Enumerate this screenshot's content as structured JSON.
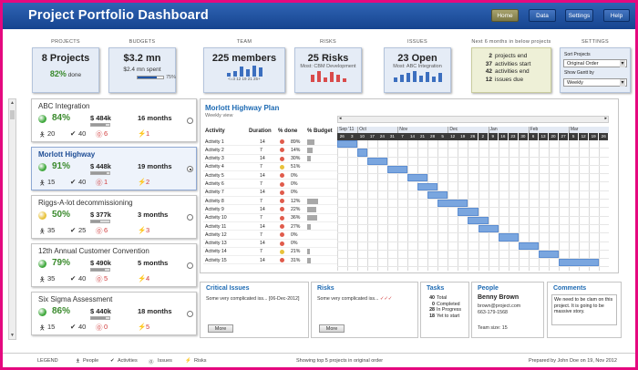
{
  "header": {
    "title": "Project Portfolio Dashboard",
    "buttons": [
      {
        "label": "Home"
      },
      {
        "label": "Data"
      },
      {
        "label": "Settings"
      },
      {
        "label": "Help"
      }
    ]
  },
  "kpis": {
    "projects": {
      "label": "PROJECTS",
      "value": "8 Projects",
      "pct": "82%",
      "pct_suffix": "done"
    },
    "budgets": {
      "label": "BUDGETS",
      "value": "$3.2 mn",
      "sub": "$2.4 mn spent",
      "bar_pct": "75%",
      "bar_fraction": 0.75
    },
    "team": {
      "label": "TEAM",
      "value": "225 members",
      "bars": [
        3,
        5,
        9,
        7,
        10,
        8
      ],
      "ticks": "<=3 12 19 21 25+"
    },
    "risks": {
      "label": "RISKS",
      "value": "25 Risks",
      "sub": "Most: CBM Development",
      "bars": [
        6,
        9,
        4,
        8,
        6,
        3
      ]
    },
    "issues": {
      "label": "ISSUES",
      "value": "23 Open",
      "sub": "Most: ABC Integration",
      "bars": [
        4,
        7,
        8,
        10,
        6,
        9,
        5,
        8
      ]
    },
    "next": {
      "label": "Next 6 months in below projects",
      "lines": [
        {
          "n": "2",
          "t": "projects end"
        },
        {
          "n": "37",
          "t": "activities start"
        },
        {
          "n": "42",
          "t": "activities end"
        },
        {
          "n": "12",
          "t": "issues due"
        }
      ]
    },
    "settings": {
      "label": "SETTINGS",
      "sort_label": "Sort Projects",
      "sort_value": "Original Order",
      "gantt_label": "Show Gantt by",
      "gantt_value": "Weekly"
    }
  },
  "projects": [
    {
      "name": "ABC Integration",
      "pct": "84%",
      "status_color": "#3fa83c",
      "budget": "$ 484k",
      "budget_fill": 0.8,
      "duration": "16 months",
      "people": "20",
      "activities": "40",
      "issues": "6",
      "risks": "1"
    },
    {
      "name": "Morlott Highway",
      "pct": "91%",
      "status_color": "#3fa83c",
      "budget": "$ 448k",
      "budget_fill": 0.85,
      "duration": "19 months",
      "people": "15",
      "activities": "40",
      "issues": "1",
      "risks": "2"
    },
    {
      "name": "Riggs-A-lot decommissioning",
      "pct": "50%",
      "status_color": "#e8c23a",
      "budget": "$ 377k",
      "budget_fill": 0.5,
      "duration": "3 months",
      "people": "35",
      "activities": "25",
      "issues": "6",
      "risks": "3"
    },
    {
      "name": "12th Annual Customer Convention",
      "pct": "79%",
      "status_color": "#3fa83c",
      "budget": "$ 490k",
      "budget_fill": 0.75,
      "duration": "5 months",
      "people": "35",
      "activities": "40",
      "issues": "5",
      "risks": "4"
    },
    {
      "name": "Six Sigma Assessment",
      "pct": "86%",
      "status_color": "#3fa83c",
      "budget": "$ 440k",
      "budget_fill": 0.8,
      "duration": "18 months",
      "people": "15",
      "activities": "40",
      "issues": "0",
      "risks": "5"
    }
  ],
  "detail": {
    "title": "Morlott Highway Plan",
    "subtitle": "Weekly view",
    "columns": {
      "activity": "Activity",
      "duration": "Duration",
      "pct": "% done",
      "budget": "% Budget"
    },
    "activities": [
      {
        "name": "Activity 1",
        "dur": "14",
        "color": "#e05b4b",
        "pct": "89%",
        "budget": 0.25
      },
      {
        "name": "Activity 2",
        "dur": "7",
        "color": "#e05b4b",
        "pct": "14%",
        "budget": 0.18
      },
      {
        "name": "Activity 3",
        "dur": "14",
        "color": "#e05b4b",
        "pct": "30%",
        "budget": 0.12
      },
      {
        "name": "Activity 4",
        "dur": "7",
        "color": "#e8c23a",
        "pct": "51%",
        "budget": 0
      },
      {
        "name": "Activity 5",
        "dur": "14",
        "color": "#e05b4b",
        "pct": "0%",
        "budget": 0
      },
      {
        "name": "Activity 6",
        "dur": "7",
        "color": "#e05b4b",
        "pct": "0%",
        "budget": 0
      },
      {
        "name": "Activity 7",
        "dur": "14",
        "color": "#e05b4b",
        "pct": "0%",
        "budget": 0
      },
      {
        "name": "Activity 8",
        "dur": "7",
        "color": "#e05b4b",
        "pct": "12%",
        "budget": 0.35
      },
      {
        "name": "Activity 9",
        "dur": "14",
        "color": "#e05b4b",
        "pct": "22%",
        "budget": 0.3
      },
      {
        "name": "Activity 10",
        "dur": "7",
        "color": "#e05b4b",
        "pct": "36%",
        "budget": 0.32
      },
      {
        "name": "Activity 11",
        "dur": "14",
        "color": "#e05b4b",
        "pct": "27%",
        "budget": 0.12
      },
      {
        "name": "Activity 12",
        "dur": "7",
        "color": "#e05b4b",
        "pct": "0%",
        "budget": 0
      },
      {
        "name": "Activity 13",
        "dur": "14",
        "color": "#e05b4b",
        "pct": "0%",
        "budget": 0
      },
      {
        "name": "Activity 14",
        "dur": "7",
        "color": "#e8c23a",
        "pct": "21%",
        "budget": 0.1
      },
      {
        "name": "Activity 15",
        "dur": "14",
        "color": "#e05b4b",
        "pct": "31%",
        "budget": 0.12
      }
    ],
    "months": [
      "Sep '11",
      "Oct",
      "Nov",
      "Dec",
      "Jan",
      "Feb",
      "Mar"
    ],
    "weeks": [
      "26",
      "3",
      "10",
      "17",
      "24",
      "31",
      "7",
      "14",
      "21",
      "28",
      "5",
      "12",
      "19",
      "26",
      "2",
      "9",
      "16",
      "23",
      "30",
      "6",
      "13",
      "20",
      "27",
      "5",
      "12",
      "19",
      "26"
    ],
    "gantt": [
      [
        0,
        2
      ],
      [
        2,
        3
      ],
      [
        3,
        5
      ],
      [
        5,
        7
      ],
      [
        7,
        9
      ],
      [
        8,
        10
      ],
      [
        9,
        11
      ],
      [
        10,
        13
      ],
      [
        12,
        14
      ],
      [
        13,
        15
      ],
      [
        14,
        16
      ],
      [
        16,
        18
      ],
      [
        18,
        20
      ],
      [
        20,
        22
      ],
      [
        22,
        26
      ]
    ]
  },
  "panels": {
    "issues": {
      "title": "Critical Issues",
      "text": "Some very complicated iss...",
      "date": "[06-Dec-2012]",
      "more": "More"
    },
    "risks": {
      "title": "Risks",
      "text": "Some very complicated iss...",
      "marks": "✓✓✓",
      "more": "More"
    },
    "tasks": {
      "title": "Tasks",
      "rows": [
        {
          "n": "40",
          "t": "Total"
        },
        {
          "n": "0",
          "t": "Completed"
        },
        {
          "n": "28",
          "t": "In Progress"
        },
        {
          "n": "18",
          "t": "Yet to start"
        }
      ]
    },
    "people": {
      "title": "People",
      "name": "Benny Brown",
      "email": "brown@project.com",
      "phone": "663-179-1568",
      "team": "Team size: 15"
    },
    "comments": {
      "title": "Comments",
      "text": "We need to be clam on this project. It is going to be massive story."
    }
  },
  "legend": {
    "label": "LEGEND",
    "items": [
      "People",
      "Activities",
      "Issues",
      "Risks"
    ],
    "center": "Showing top 5 projects in original order",
    "right": "Prepared by John Doe on 19, Nov 2012"
  }
}
